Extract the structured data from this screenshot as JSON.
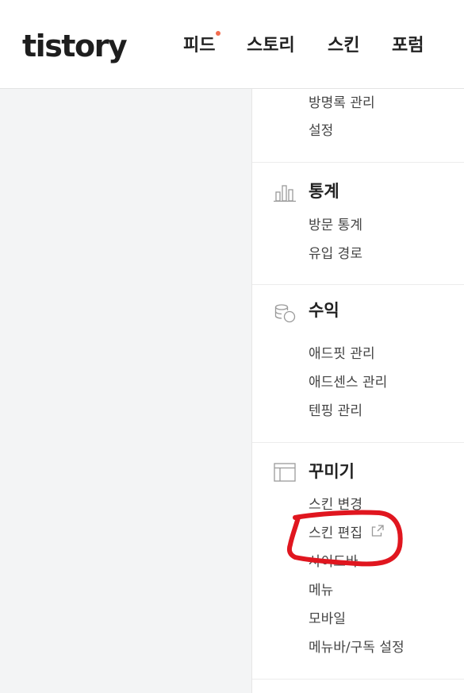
{
  "header": {
    "logo": "tistory",
    "nav": [
      {
        "label": "피드",
        "has_dot": true
      },
      {
        "label": "스토리"
      },
      {
        "label": "스킨"
      },
      {
        "label": "포럼"
      }
    ]
  },
  "sidebar": {
    "top_links": [
      "방명록 관리",
      "설정"
    ],
    "sections": [
      {
        "title": "통계",
        "icon": "bar-chart-icon",
        "links": [
          "방문 통계",
          "유입 경로"
        ]
      },
      {
        "title": "수익",
        "icon": "coins-icon",
        "links": [
          "애드핏 관리",
          "애드센스 관리",
          "텐핑 관리"
        ]
      },
      {
        "title": "꾸미기",
        "icon": "layout-icon",
        "links": [
          "스킨 변경",
          "스킨 편집",
          "사이드바",
          "메뉴",
          "모바일",
          "메뉴바/구독 설정"
        ]
      }
    ]
  },
  "colors": {
    "accent_dot": "#f26c4f",
    "annotation": "#e0161f"
  }
}
